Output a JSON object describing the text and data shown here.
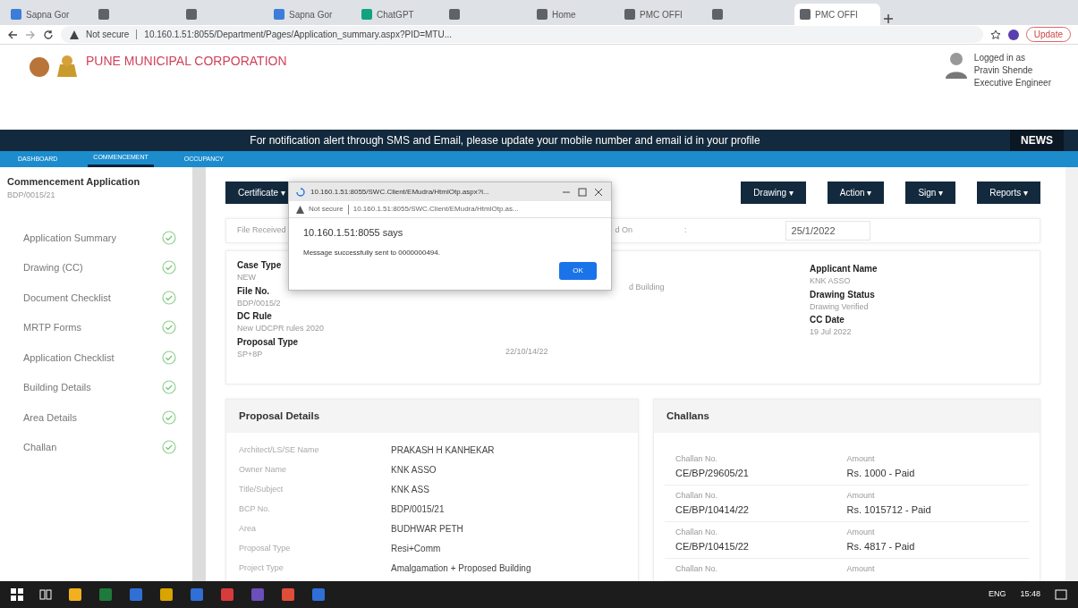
{
  "browser": {
    "tabs": [
      {
        "title": "Sapna Gor",
        "selected": false,
        "color": "#3b7dd8"
      },
      {
        "selected": false,
        "color": "#5f6368"
      },
      {
        "selected": false,
        "color": "#5f6368"
      },
      {
        "title": "Sapna Gor",
        "selected": false,
        "color": "#3b7dd8"
      },
      {
        "title": "ChatGPT",
        "selected": false,
        "color": "#10a37f"
      },
      {
        "selected": false,
        "color": "#5f6368"
      },
      {
        "title": "Home",
        "selected": false,
        "color": "#5f6368"
      },
      {
        "title": "PMC OFFI",
        "selected": false,
        "color": "#5f6368"
      },
      {
        "selected": false,
        "color": "#5f6368"
      },
      {
        "title": "PMC OFFI",
        "selected": true,
        "color": "#5f6368"
      }
    ],
    "security": "Not secure",
    "url": "10.160.1.51:8055/Department/Pages/Application_summary.aspx?PID=MTU...",
    "update_label": "Update"
  },
  "header": {
    "org_name": "PUNE MUNICIPAL CORPORATION",
    "logged_in_label": "Logged in as",
    "user_name": "Pravin Shende",
    "user_role": "Executive Engineer"
  },
  "banner": {
    "text": "For notification alert through SMS and Email, please update your mobile number and email id in your profile",
    "news_label": "NEWS"
  },
  "nav": [
    {
      "label": "DASHBOARD",
      "selected": false
    },
    {
      "label": "COMMENCEMENT",
      "selected": true
    },
    {
      "label": "OCCUPANCY",
      "selected": false
    }
  ],
  "sidebar": {
    "title": "Commencement Application",
    "subtitle": "BDP/0015/21",
    "items": [
      {
        "label": "Application Summary",
        "done": true
      },
      {
        "label": "Drawing (CC)",
        "done": true
      },
      {
        "label": "Document Checklist",
        "done": true
      },
      {
        "label": "MRTP Forms",
        "done": true
      },
      {
        "label": "Application Checklist",
        "done": true
      },
      {
        "label": "Building Details",
        "done": true
      },
      {
        "label": "Area Details",
        "done": true
      },
      {
        "label": "Challan",
        "done": true
      }
    ]
  },
  "toolbar": {
    "left": "Certificate ▾",
    "right": [
      "Drawing ▾",
      "Action ▾",
      "Sign ▾",
      "Reports ▾"
    ]
  },
  "file_row": {
    "label": "File Received",
    "label_2": "d On",
    "separator": ":",
    "date": "25/1/2022"
  },
  "summary": {
    "left": [
      {
        "label": "Case Type",
        "value": "NEW"
      },
      {
        "label": "File No.",
        "value": "BDP/0015/2"
      },
      {
        "label": "DC Rule",
        "value": "New UDCPR rules 2020"
      },
      {
        "label": "Proposal Type",
        "value": "SP+8P"
      }
    ],
    "middle": [
      "d Building",
      "22/10/14/22"
    ],
    "right": [
      {
        "label": "Applicant Name",
        "value": "KNK ASSO"
      },
      {
        "label": "Drawing Status",
        "value": "Drawing Verified"
      },
      {
        "label": "CC Date",
        "value": "19 Jul 2022"
      }
    ]
  },
  "proposal": {
    "title": "Proposal Details",
    "rows": [
      {
        "label": "Architect/LS/SE Name",
        "value": "PRAKASH H KANHEKAR"
      },
      {
        "label": "Owner Name",
        "value": "KNK ASSO"
      },
      {
        "label": "Title/Subject",
        "value": "KNK ASS"
      },
      {
        "label": "BCP No.",
        "value": "BDP/0015/21"
      },
      {
        "label": "Area",
        "value": "BUDHWAR PETH"
      },
      {
        "label": "Proposal Type",
        "value": "Resi+Comm"
      },
      {
        "label": "Project Type",
        "value": "Amalgamation + Proposed Building"
      }
    ]
  },
  "challans": {
    "title": "Challans",
    "items": [
      {
        "no_label": "Challan No.",
        "no": "CE/BP/29605/21",
        "amount_label": "Amount",
        "amount": "Rs. 1000 - Paid"
      },
      {
        "no_label": "Challan No.",
        "no": "CE/BP/10414/22",
        "amount_label": "Amount",
        "amount": "Rs. 1015712 - Paid"
      },
      {
        "no_label": "Challan No.",
        "no": "CE/BP/10415/22",
        "amount_label": "Amount",
        "amount": "Rs. 4817 - Paid"
      },
      {
        "no_label": "Challan No.",
        "amount_label": "Amount"
      }
    ]
  },
  "popup": {
    "title_url": "10.160.1.51:8055/SWC.Client/EMudra/HtmlOtp.aspx?i...",
    "security": "Not secure",
    "url": "10.160.1.51:8055/SWC.Client/EMudra/HtmlOtp.as...",
    "heading": "10.160.1.51:8055 says",
    "message": "Message successfully sent to 0000000494.",
    "ok_label": "OK"
  },
  "taskbar": {
    "apps": [
      {
        "color": "#f2b01e"
      },
      {
        "color": "#1e7a3a"
      },
      {
        "color": "#2f6fd6"
      },
      {
        "color": "#d9a400"
      },
      {
        "color": "#2f6fd6"
      },
      {
        "color": "#d83b3b"
      },
      {
        "color": "#6b4fbb"
      },
      {
        "color": "#e04e39"
      },
      {
        "color": "#2f6fd6"
      }
    ],
    "language": "ENG",
    "time": "15:48"
  }
}
